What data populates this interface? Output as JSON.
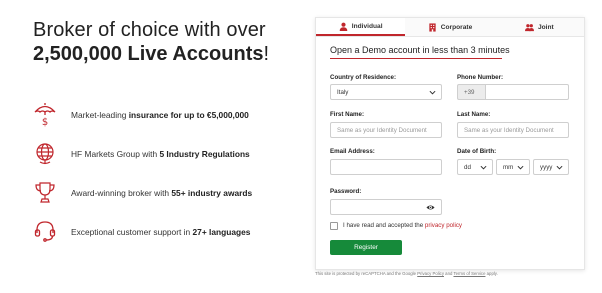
{
  "headline": {
    "line1": "Broker of choice with over",
    "line2_bold": "2,500,000 Live Accounts",
    "line2_suffix": "!"
  },
  "features": [
    {
      "icon": "umbrella-dollar-icon",
      "pre": "Market-leading ",
      "bold": "insurance for up to €5,000,000",
      "post": ""
    },
    {
      "icon": "globe-icon",
      "pre": "HF Markets Group with ",
      "bold": "5 Industry Regulations",
      "post": ""
    },
    {
      "icon": "trophy-icon",
      "pre": "Award-winning broker with ",
      "bold": "55+ industry awards",
      "post": ""
    },
    {
      "icon": "headset-icon",
      "pre": "Exceptional customer support in ",
      "bold": "27+ languages",
      "post": ""
    }
  ],
  "tabs": [
    {
      "label": "Individual",
      "icon": "person-icon",
      "active": true
    },
    {
      "label": "Corporate",
      "icon": "building-icon",
      "active": false
    },
    {
      "label": "Joint",
      "icon": "people-icon",
      "active": false
    }
  ],
  "form": {
    "title": "Open a Demo account in less than 3 minutes",
    "country_label": "Country of Residence:",
    "country_value": "Italy",
    "phone_label": "Phone Number:",
    "phone_prefix": "+39",
    "phone_value": "",
    "first_name_label": "First Name:",
    "first_name_placeholder": "Same as your Identity Document",
    "last_name_label": "Last Name:",
    "last_name_placeholder": "Same as your Identity Document",
    "email_label": "Email Address:",
    "email_value": "",
    "dob_label": "Date of Birth:",
    "dob_day": "dd",
    "dob_month": "mm",
    "dob_year": "yyyy",
    "password_label": "Password:",
    "password_value": "",
    "agree_text": "I have read and accepted the ",
    "agree_link": "privacy policy",
    "register_label": "Register"
  },
  "recaptcha": {
    "pre": "This site is protected by reCAPTCHA and the Google ",
    "privacy": "Privacy Policy",
    "mid": " and ",
    "terms": "Terms of Service",
    "post": " apply."
  },
  "colors": {
    "accent": "#c0262c",
    "button": "#168a3a"
  }
}
